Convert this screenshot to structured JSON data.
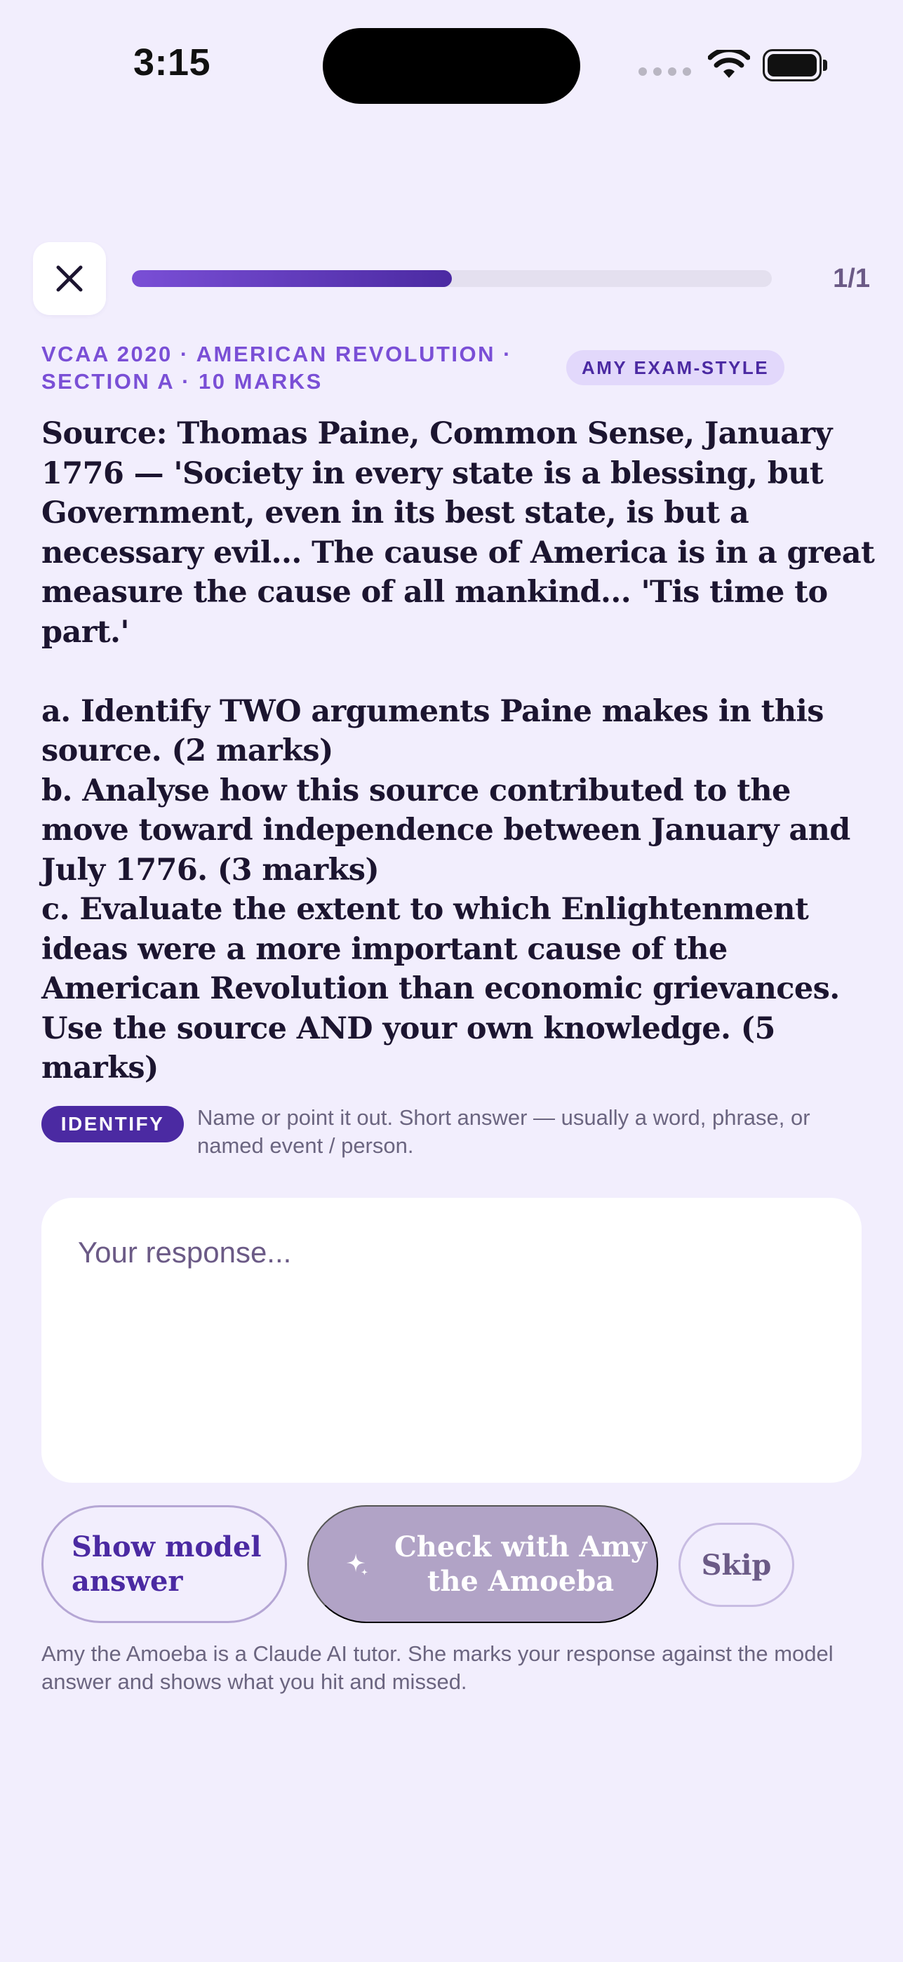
{
  "status_bar": {
    "time": "3:15"
  },
  "header": {
    "progress_label": "1/1",
    "progress_fraction": 0.5
  },
  "meta": {
    "text": "VCAA 2020 · AMERICAN REVOLUTION · SECTION A · 10 MARKS",
    "badge": "AMY EXAM-STYLE"
  },
  "question": {
    "text": "Source: Thomas Paine, Common Sense, January 1776 — 'Society in every state is a blessing, but Government, even in its best state, is but a necessary evil... The cause of America is in a great measure the cause of all mankind... 'Tis time to part.'\n\na. Identify TWO arguments Paine makes in this source. (2 marks)\nb. Analyse how this source contributed to the move toward independence between January and July 1776. (3 marks)\nc. Evaluate the extent to which Enlightenment ideas were a more important cause of the American Revolution than economic grievances. Use the source AND your own knowledge. (5 marks)"
  },
  "command_term": {
    "badge": "IDENTIFY",
    "description": "Name or point it out. Short answer — usually a word, phrase, or named event / person."
  },
  "response": {
    "placeholder": "Your response...",
    "value": ""
  },
  "actions": {
    "model_answer_label": "Show model answer",
    "check_label": "Check with Amy the Amoeba",
    "skip_label": "Skip"
  },
  "footnote": "Amy the Amoeba is a Claude AI tutor. She marks your response against the model answer and shows what you hit and missed.",
  "colors": {
    "background": "#f2eefd",
    "accent": "#7a4fd6",
    "accent_dark": "#4b2aa2",
    "disabled_button": "#b1a3c6"
  }
}
